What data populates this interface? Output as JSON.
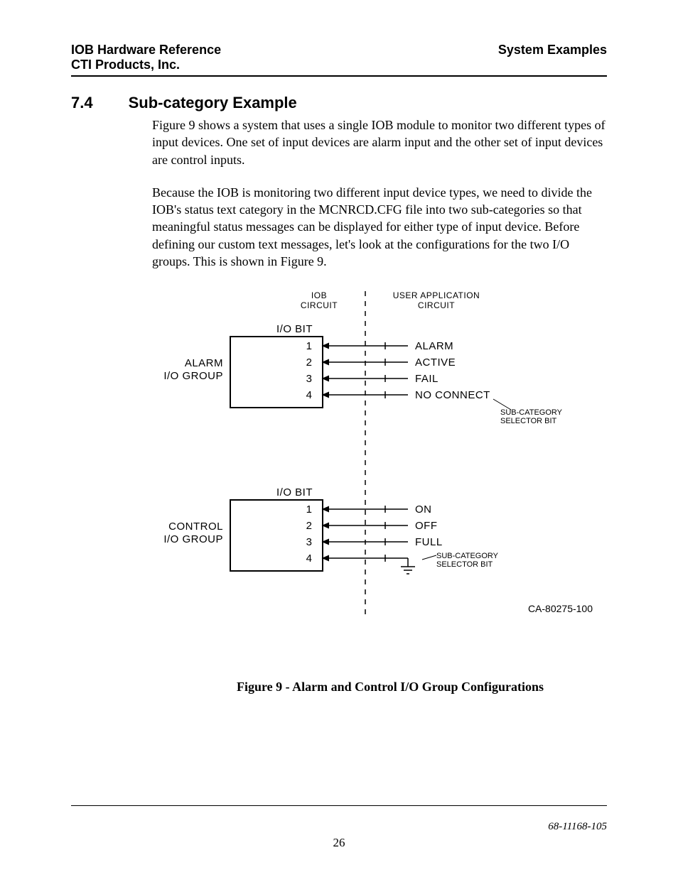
{
  "header": {
    "left_line1": "IOB Hardware Reference",
    "left_line2": "CTI Products, Inc.",
    "right": "System Examples"
  },
  "section": {
    "number": "7.4",
    "title": "Sub-category Example"
  },
  "paragraphs": {
    "p1": "Figure 9 shows a system that uses a single IOB module to monitor two different types of input devices.  One set of input devices are alarm input and the other set of input devices are control inputs.",
    "p2": "Because the IOB is monitoring two different input device types, we need to divide the IOB's status text category in the MCNRCD.CFG file into two sub-categories so that meaningful status messages can be displayed for either type of input device.  Before defining our custom text messages, let's look at the configurations for the two I/O groups.  This is shown in Figure 9."
  },
  "diagram": {
    "col_left_l1": "IOB",
    "col_left_l2": "CIRCUIT",
    "col_right_l1": "USER APPLICATION",
    "col_right_l2": "CIRCUIT",
    "io_bit": "I/O BIT",
    "group1_l1": "ALARM",
    "group1_l2": "I/O GROUP",
    "group1_sig1": "ALARM",
    "group1_sig2": "ACTIVE",
    "group1_sig3": "FAIL",
    "group1_sig4": "NO CONNECT",
    "group2_l1": "CONTROL",
    "group2_l2": "I/O GROUP",
    "group2_sig1": "ON",
    "group2_sig2": "OFF",
    "group2_sig3": "FULL",
    "subcat_l1": "SUB-CATEGORY",
    "subcat_l2": "SELECTOR BIT",
    "bit1": "1",
    "bit2": "2",
    "bit3": "3",
    "bit4": "4",
    "part_number": "CA-80275-100"
  },
  "figure_caption": "Figure 9 - Alarm and Control I/O Group Configurations",
  "footer": {
    "doc_id": "68-11168-105",
    "page": "26"
  }
}
